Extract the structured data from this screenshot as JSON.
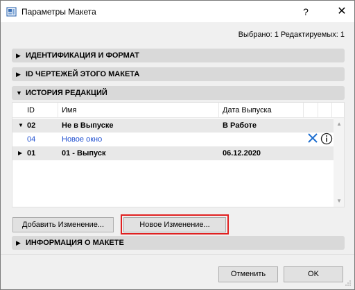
{
  "window": {
    "title": "Параметры Макета",
    "help_glyph": "?",
    "close_glyph": "✕"
  },
  "selection_status": "Выбрано: 1 Редактируемых: 1",
  "sections": [
    {
      "label": "ИДЕНТИФИКАЦИЯ И ФОРМАТ",
      "expanded": false
    },
    {
      "label": "ID ЧЕРТЕЖЕЙ ЭТОГО МАКЕТА",
      "expanded": false
    },
    {
      "label": "ИСТОРИЯ РЕДАКЦИЙ",
      "expanded": true
    },
    {
      "label": "ИНФОРМАЦИЯ О МАКЕТЕ",
      "expanded": false
    }
  ],
  "revision_table": {
    "columns": [
      "ID",
      "Имя",
      "Дата Выпуска"
    ],
    "rows": [
      {
        "id": "02",
        "name": "Не в Выпуске",
        "date": "В Работе",
        "kind": "group",
        "expanded": true
      },
      {
        "id": "04",
        "name": "Новое окно",
        "date": "",
        "kind": "change"
      },
      {
        "id": "01",
        "name": "01 - Выпуск",
        "date": "06.12.2020",
        "kind": "group",
        "expanded": false
      }
    ]
  },
  "buttons": {
    "add_change": "Добавить Изменение...",
    "new_change": "Новое Изменение...",
    "cancel": "Отменить",
    "ok": "OK"
  },
  "icons": {
    "app": "layout-icon",
    "delete": "x-icon",
    "info": "info-icon"
  },
  "colors": {
    "link_blue": "#1f4fd0",
    "highlight_red": "#e02020",
    "section_grey": "#d9d9d9"
  }
}
